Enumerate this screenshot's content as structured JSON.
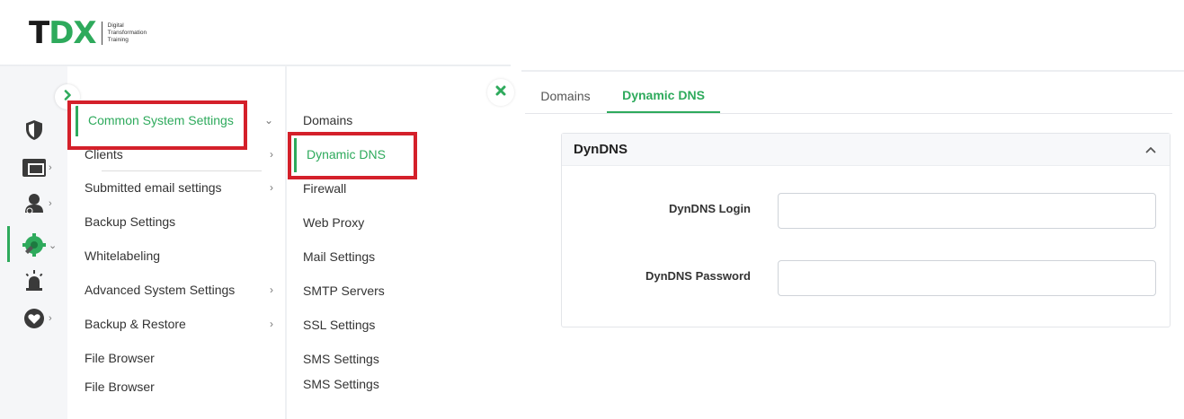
{
  "logo": {
    "mark_t": "T",
    "mark_dx": "DX",
    "tagline": [
      "Digital",
      "Transformation",
      "Training"
    ]
  },
  "rail": {
    "icons": [
      "shield-icon",
      "dashboard-icon",
      "user-icon",
      "gear-icon",
      "alarm-icon",
      "heart-icon"
    ],
    "chevron": "›",
    "chevron_down": "⌄"
  },
  "menu1": {
    "items": [
      {
        "label": "Common System Settings",
        "chevron": "⌄"
      },
      {
        "label": "Clients",
        "chevron": "›"
      },
      {
        "label": "Submitted email settings",
        "chevron": "›"
      },
      {
        "label": "Backup Settings",
        "chevron": ""
      },
      {
        "label": "Whitelabeling",
        "chevron": ""
      },
      {
        "label": "Advanced System Settings",
        "chevron": "›"
      },
      {
        "label": "Backup & Restore",
        "chevron": "›"
      },
      {
        "label": "File Browser",
        "chevron": ""
      },
      {
        "label": "File Browser",
        "chevron": ""
      }
    ]
  },
  "menu2": {
    "items": [
      {
        "label": "Domains"
      },
      {
        "label": "Dynamic DNS"
      },
      {
        "label": "Firewall"
      },
      {
        "label": "Web Proxy"
      },
      {
        "label": "Mail Settings"
      },
      {
        "label": "SMTP Servers"
      },
      {
        "label": "SSL Settings"
      },
      {
        "label": "SMS Settings"
      },
      {
        "label": "SMS Settings"
      }
    ]
  },
  "tabs": [
    {
      "label": "Domains"
    },
    {
      "label": "Dynamic DNS"
    }
  ],
  "panel": {
    "title": "DynDNS",
    "login_label": "DynDNS Login",
    "login_value": "",
    "password_label": "DynDNS Password",
    "password_value": ""
  },
  "colors": {
    "accent": "#2eaa5c",
    "highlight": "#d4202a"
  }
}
